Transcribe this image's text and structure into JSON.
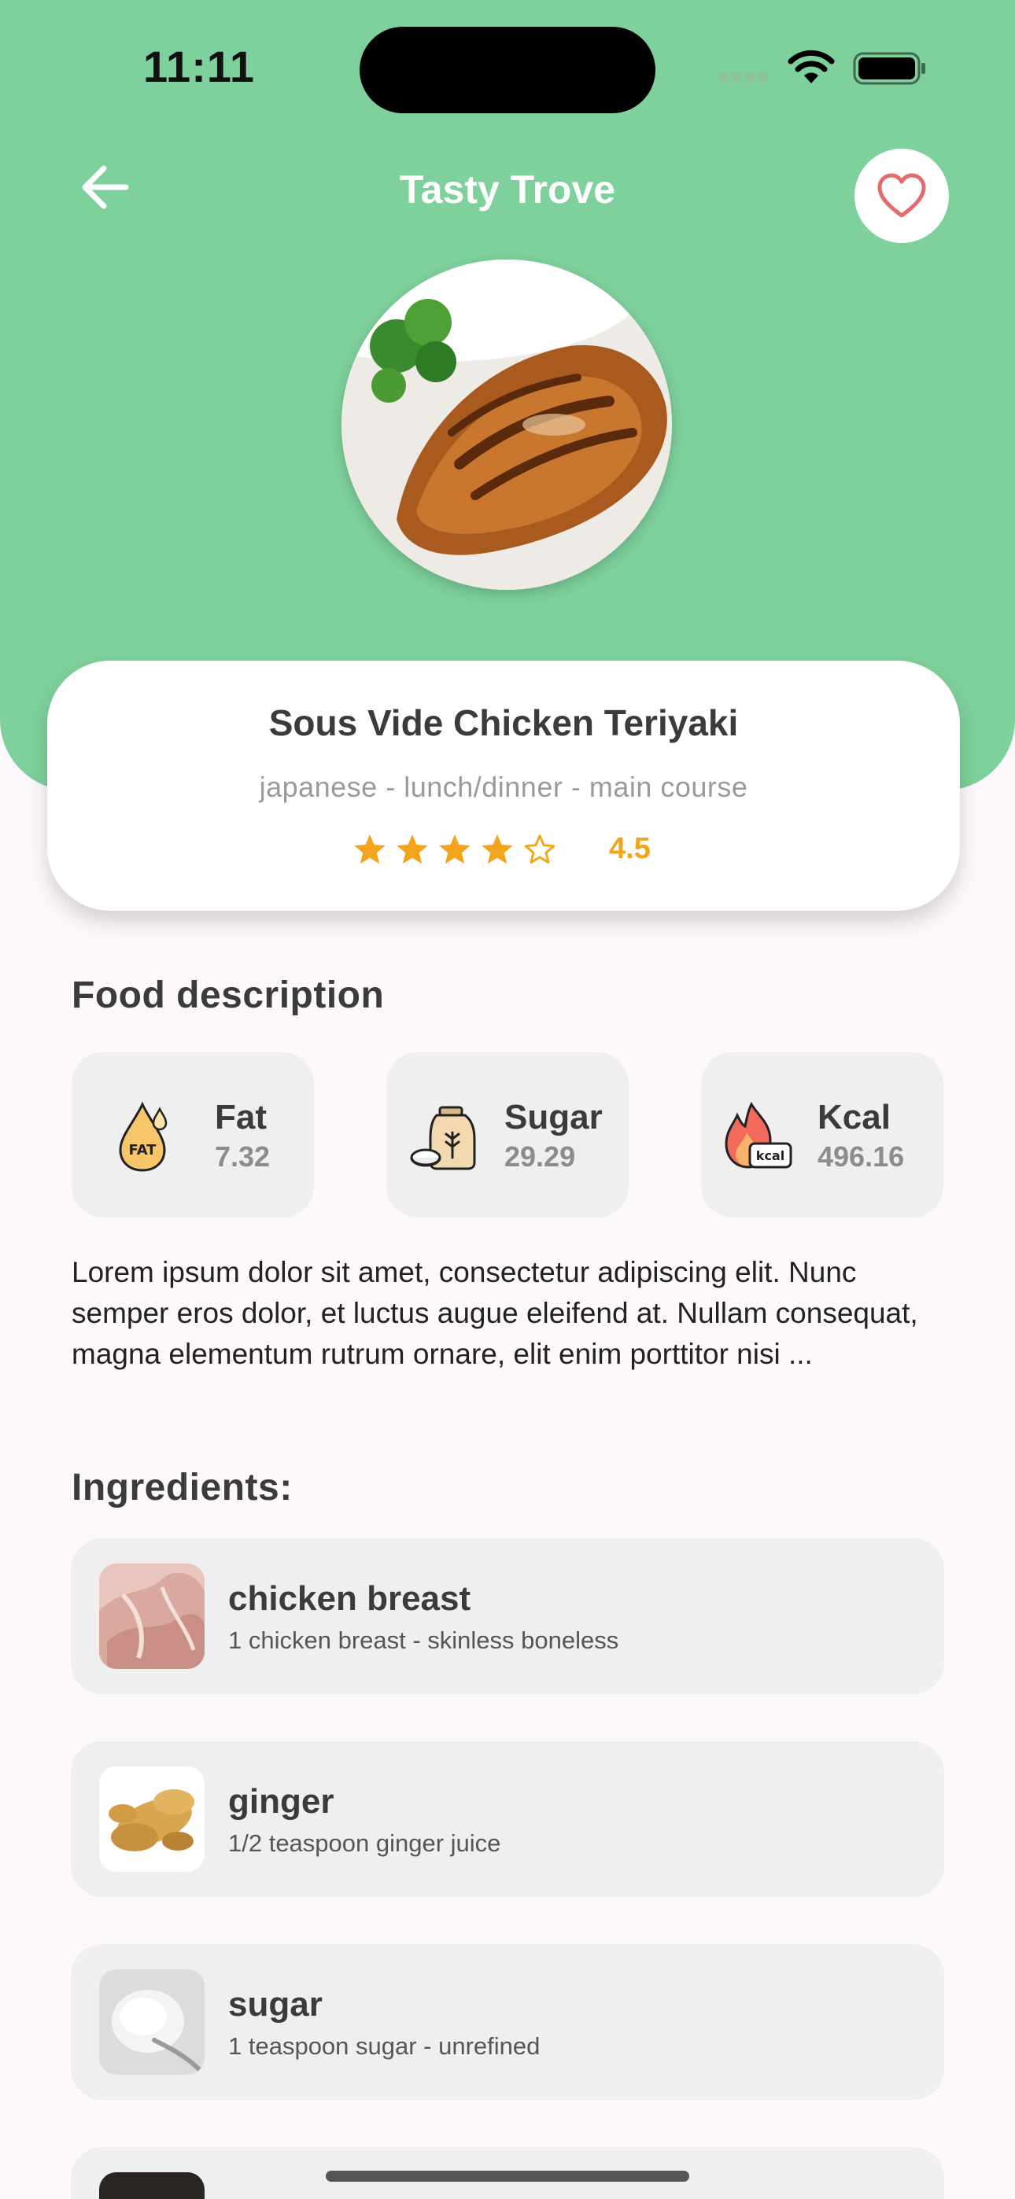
{
  "status_bar": {
    "time": "11:11"
  },
  "header": {
    "title": "Tasty Trove"
  },
  "recipe": {
    "name": "Sous Vide Chicken Teriyaki",
    "tags": "japanese - lunch/dinner - main course",
    "rating": 4.5,
    "rating_label": "4.5",
    "stars": [
      "full",
      "full",
      "full",
      "full",
      "outline"
    ]
  },
  "description": {
    "title": "Food description",
    "nutrition": [
      {
        "label": "Fat",
        "value": "7.32",
        "icon": "fat-drop-icon"
      },
      {
        "label": "Sugar",
        "value": "29.29",
        "icon": "sugar-jar-icon"
      },
      {
        "label": "Kcal",
        "value": "496.16",
        "icon": "kcal-flame-icon"
      }
    ],
    "text": "Lorem ipsum dolor sit amet, consectetur adipiscing elit. Nunc semper eros dolor, et luctus augue eleifend at. Nullam consequat, magna elementum rutrum ornare, elit enim porttitor nisi ..."
  },
  "ingredients": {
    "title": "Ingredients:",
    "items": [
      {
        "name": "chicken breast",
        "detail": "1 chicken breast - skinless boneless"
      },
      {
        "name": "ginger",
        "detail": "1/2 teaspoon ginger juice"
      },
      {
        "name": "sugar",
        "detail": "1 teaspoon sugar - unrefined"
      },
      {
        "name": "",
        "detail": ""
      }
    ]
  },
  "colors": {
    "header_green": "#7ed09c",
    "star": "#f2a51c",
    "heart": "#e46b6b",
    "card_gray": "#efefef"
  }
}
